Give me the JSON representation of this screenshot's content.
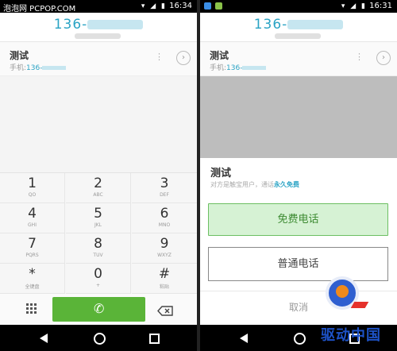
{
  "watermark_left": "泡泡网 PCPOP.COM",
  "watermark_right": "驱动中国",
  "left_screen": {
    "status": {
      "time": "16:34"
    },
    "dialed_number": "136-",
    "contact": {
      "name": "测试",
      "phone_prefix": "手机:",
      "phone_number": "136-"
    },
    "keypad": [
      {
        "digit": "1",
        "letters": "QO"
      },
      {
        "digit": "2",
        "letters": "ABC"
      },
      {
        "digit": "3",
        "letters": "DEF"
      },
      {
        "digit": "4",
        "letters": "GHI"
      },
      {
        "digit": "5",
        "letters": "JKL"
      },
      {
        "digit": "6",
        "letters": "MNO"
      },
      {
        "digit": "7",
        "letters": "PQRS"
      },
      {
        "digit": "8",
        "letters": "TUV"
      },
      {
        "digit": "9",
        "letters": "WXYZ"
      },
      {
        "digit": "*",
        "letters": "全键盘"
      },
      {
        "digit": "0",
        "letters": "+"
      },
      {
        "digit": "#",
        "letters": "粘贴"
      }
    ]
  },
  "right_screen": {
    "status": {
      "time": "16:31"
    },
    "dialed_number": "136-",
    "contact": {
      "name": "测试",
      "phone_prefix": "手机:",
      "phone_number": "136-"
    },
    "sheet": {
      "title": "测试",
      "desc_prefix": "对方是触宝用户，通话",
      "desc_highlight": "永久免费",
      "free_call_label": "免费电话",
      "normal_call_label": "普通电话",
      "cancel_label": "取消"
    }
  },
  "colors": {
    "accent_blue": "#2aa3c4",
    "call_green": "#5ab438",
    "free_green_bg": "#d6f2d4"
  },
  "icons": [
    "wifi-icon",
    "signal-icon",
    "battery-icon",
    "more-icon",
    "chevron-right-icon",
    "dialpad-grid-icon",
    "phone-icon",
    "backspace-icon",
    "back-icon",
    "home-icon",
    "recents-icon"
  ]
}
